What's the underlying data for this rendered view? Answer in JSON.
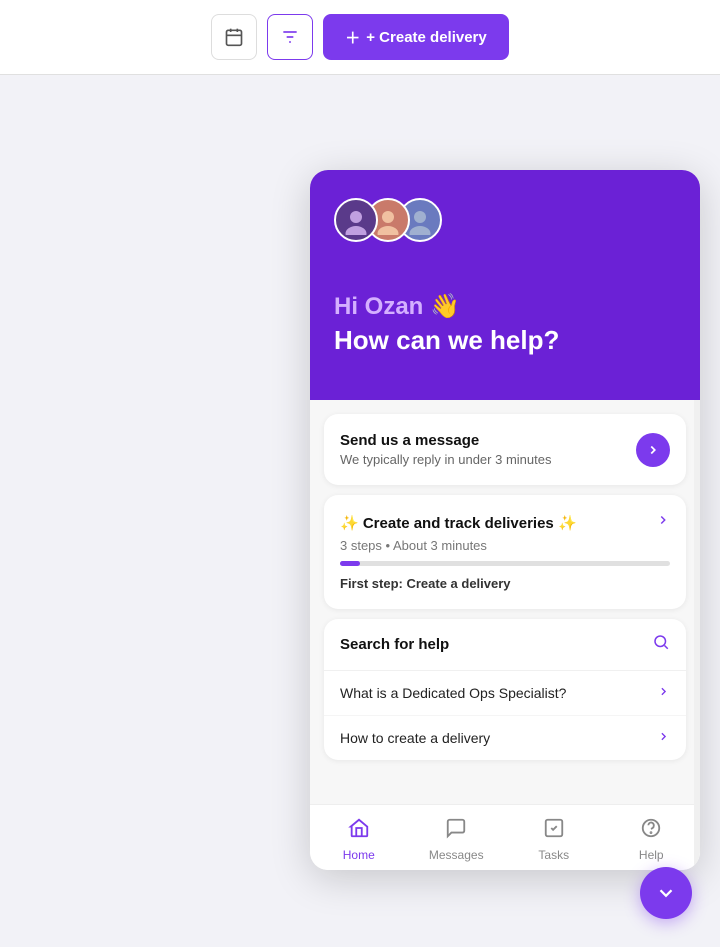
{
  "topbar": {
    "calendar_label": "📅",
    "filter_label": "⚙",
    "create_delivery_label": "+ Create delivery"
  },
  "widget": {
    "header": {
      "greeting_hi": "Hi Ozan 👋",
      "greeting_main": "How can we help?"
    },
    "send_message": {
      "title": "Send us a message",
      "subtitle": "We typically reply in under 3 minutes",
      "arrow": "▶"
    },
    "tutorial": {
      "title": "✨ Create and track deliveries ✨",
      "steps_info": "3 steps • About 3 minutes",
      "first_step_label": "First step:",
      "first_step_value": "Create a delivery",
      "progress": 6
    },
    "search": {
      "label": "Search for help",
      "items": [
        {
          "text": "What is a Dedicated Ops Specialist?"
        },
        {
          "text": "How to create a delivery"
        }
      ]
    },
    "footer": {
      "home": "Home",
      "messages": "Messages",
      "tasks": "Tasks",
      "help": "Help"
    },
    "fab": "⌄"
  }
}
